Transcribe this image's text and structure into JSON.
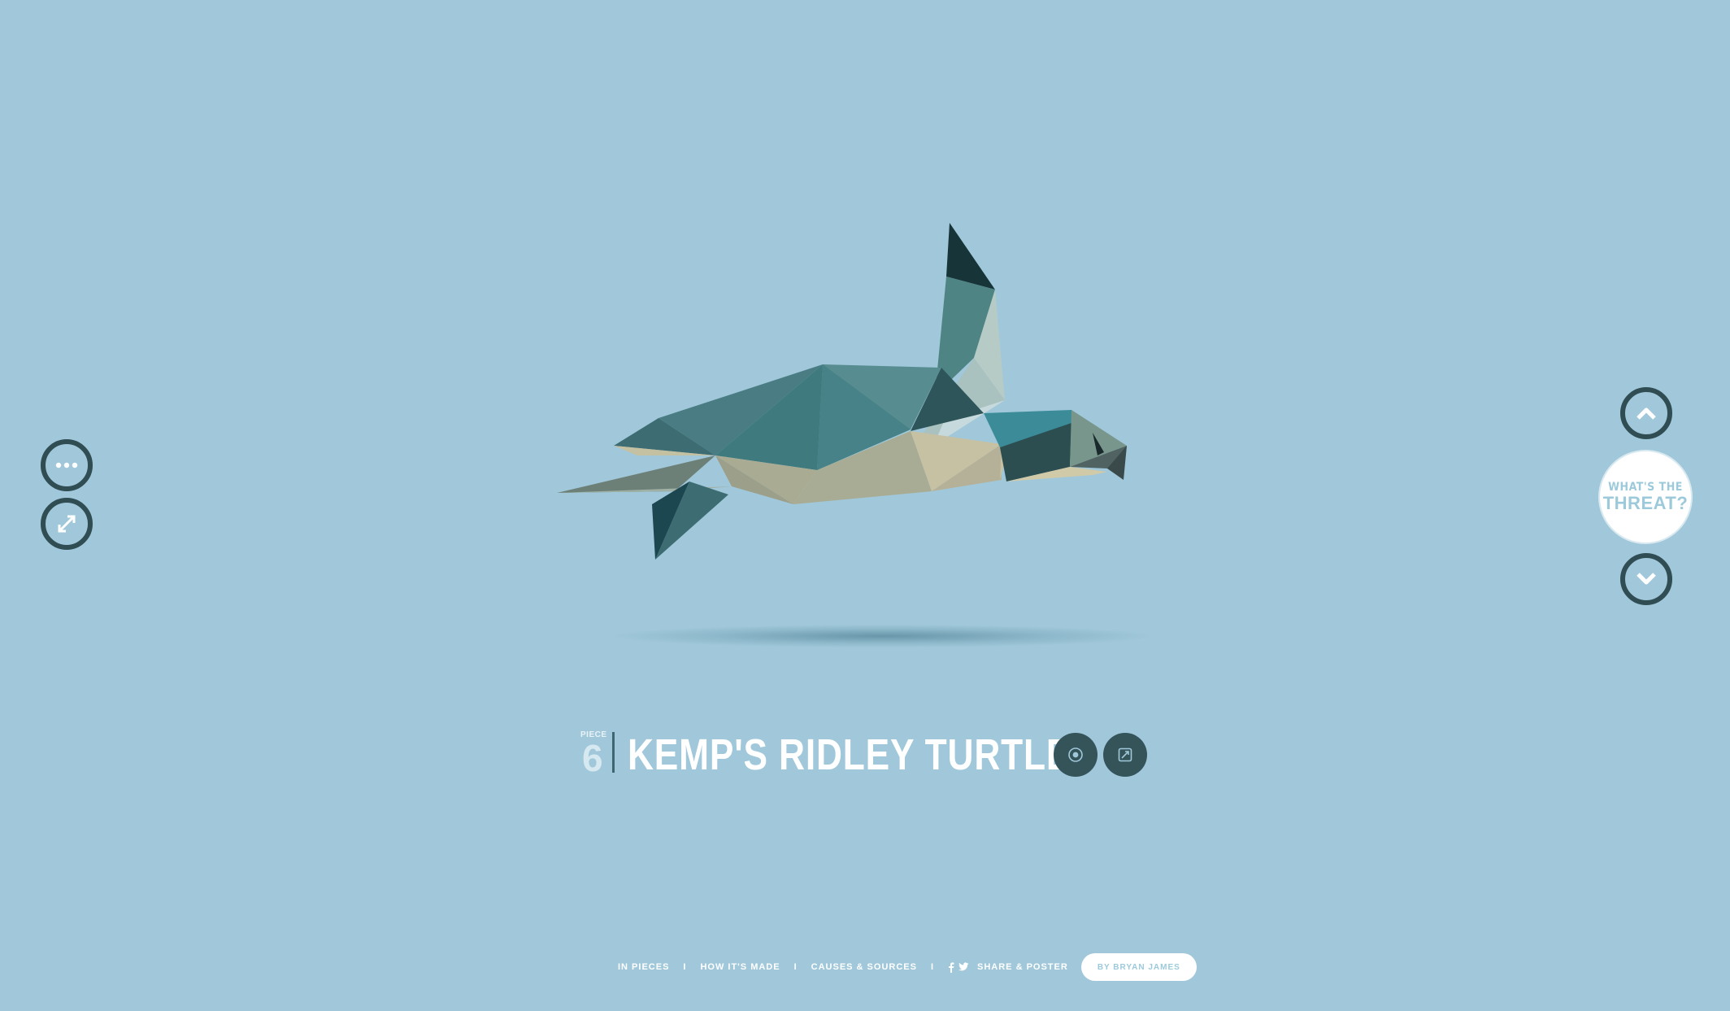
{
  "page": {
    "background": "#a0c8da"
  },
  "left_controls": {
    "menu_icon": "ellipsis-icon",
    "shuffle_icon": "shuffle-icon"
  },
  "right_controls": {
    "up_icon": "chevron-up-icon",
    "down_icon": "chevron-down-icon",
    "threat_button": {
      "line1": "WHAT'S THE",
      "line2": "THREAT?"
    }
  },
  "piece": {
    "label": "PIECE",
    "number": "6",
    "title": "KEMP'S RIDLEY TURTLE",
    "sound_icon": "sound-icon",
    "info_icon": "external-link-icon"
  },
  "footer": {
    "links": [
      "IN PIECES",
      "HOW IT'S MADE",
      "CAUSES & SOURCES",
      "SHARE & POSTER"
    ],
    "separator": "I",
    "social_icons": [
      "facebook-icon",
      "twitter-icon"
    ],
    "author": "BY BRYAN JAMES"
  },
  "colors": {
    "stamp_dark": "#2f4d52",
    "accent_light": "#9ccadb",
    "white": "#ffffff"
  }
}
